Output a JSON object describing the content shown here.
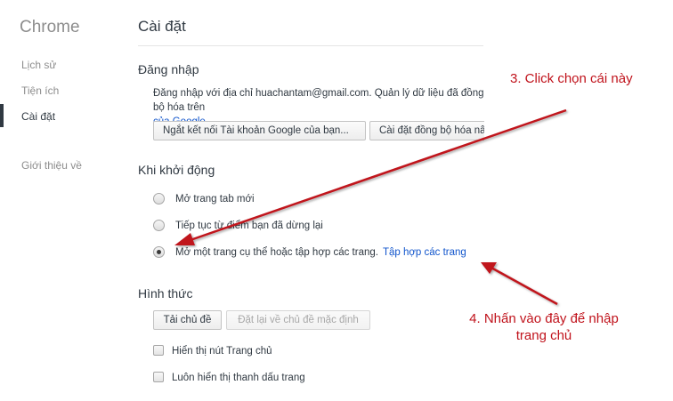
{
  "sidebar": {
    "app_name": "Chrome",
    "items": [
      {
        "label": "Lịch sử"
      },
      {
        "label": "Tiện ích"
      },
      {
        "label": "Cài đặt"
      },
      {
        "label": "Giới thiệu về"
      }
    ]
  },
  "page_title": "Cài đặt",
  "signin": {
    "heading": "Đăng nhập",
    "text": "Đăng nhập với địa chỉ huachantam@gmail.com. Quản lý dữ liệu đã đồng bộ hóa trên",
    "link": "của Google",
    "link_suffix": ".",
    "disconnect_button": "Ngắt kết nối Tài khoản Google của bạn...",
    "sync_button": "Cài đặt đồng bộ hóa nâng cao..."
  },
  "startup": {
    "heading": "Khi khởi động",
    "options": [
      {
        "label": "Mở trang tab mới",
        "checked": false
      },
      {
        "label": "Tiếp tục từ điểm bạn đã dừng lại",
        "checked": false
      },
      {
        "label": "Mở một trang cụ thể hoặc tập hợp các trang.",
        "checked": true,
        "link": "Tập hợp các trang"
      }
    ]
  },
  "appearance": {
    "heading": "Hình thức",
    "theme_button": "Tải chủ đề",
    "reset_theme_button": "Đặt lại về chủ đề mặc định",
    "checkboxes": [
      {
        "label": "Hiển thị nút Trang chủ",
        "checked": false
      },
      {
        "label": "Luôn hiển thị thanh dấu trang",
        "checked": false
      }
    ]
  },
  "annotations": {
    "step3": "3. Click chọn cái này",
    "step4_line1": "4. Nhấn vào đây để nhập",
    "step4_line2": "trang chủ",
    "color": "#c0121b"
  }
}
